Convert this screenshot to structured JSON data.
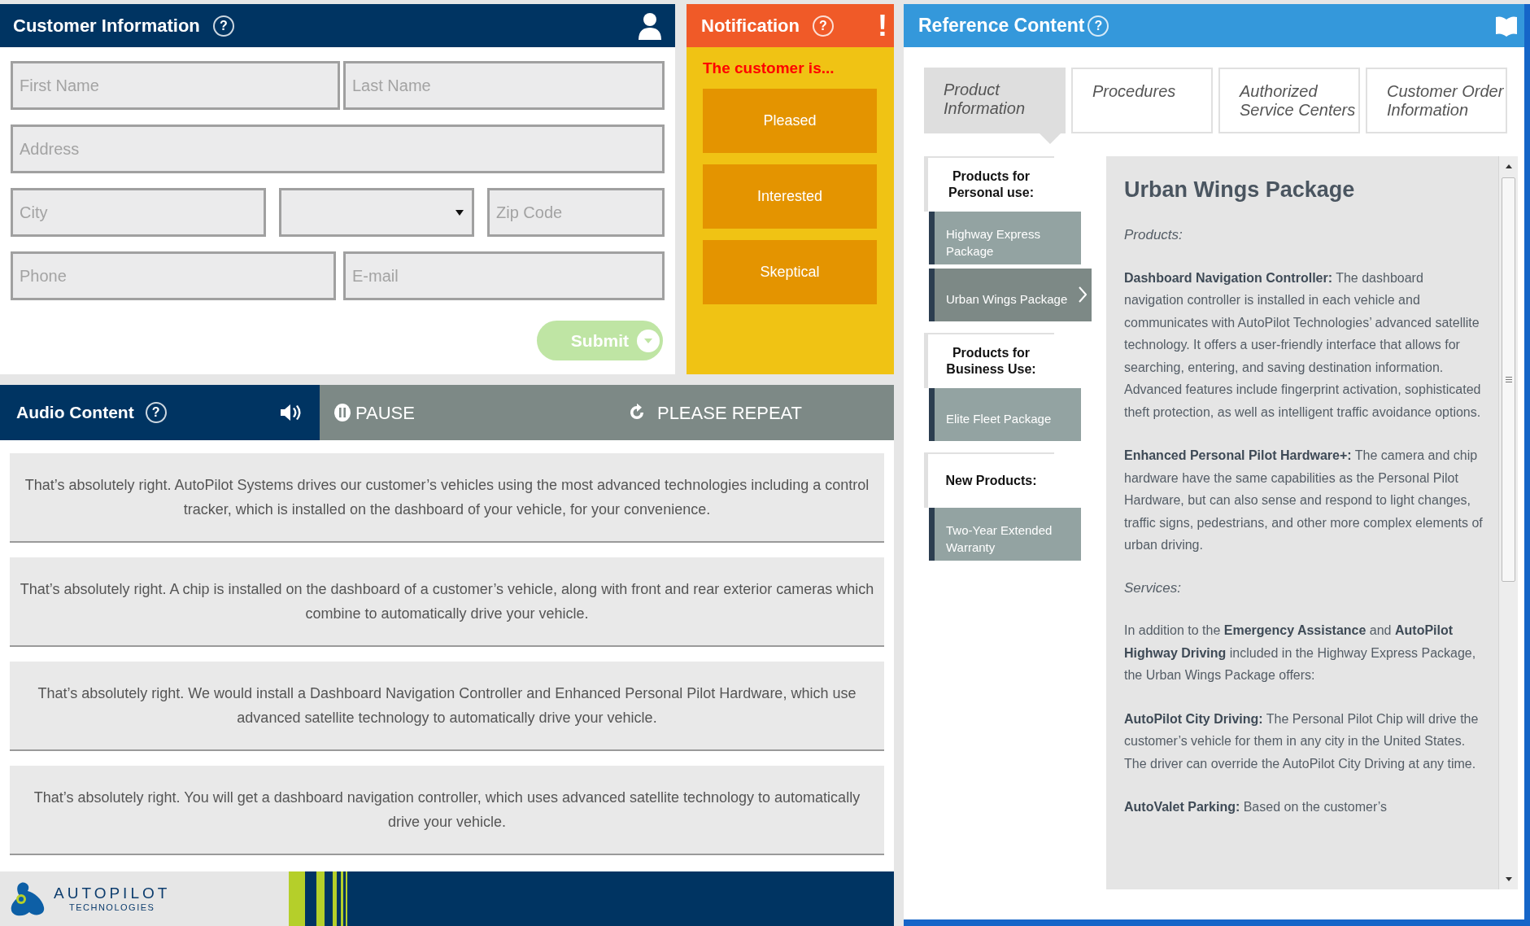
{
  "customer_information": {
    "title": "Customer Information",
    "help": "?",
    "rows": [
      [
        {
          "kind": "text",
          "placeholder": "First Name"
        },
        {
          "kind": "text",
          "placeholder": "Last Name"
        }
      ],
      [
        {
          "kind": "text",
          "placeholder": "Address"
        }
      ],
      [
        {
          "kind": "text",
          "placeholder": "City"
        },
        {
          "kind": "select"
        },
        {
          "kind": "text",
          "placeholder": "Zip Code"
        }
      ],
      [
        {
          "kind": "text",
          "placeholder": "Phone"
        },
        {
          "kind": "text",
          "placeholder": "E-mail"
        }
      ]
    ],
    "submit": "Submit"
  },
  "notification": {
    "title": "Notification",
    "help": "?",
    "alert": "!",
    "prompt": "The customer is...",
    "options": [
      "Pleased",
      "Interested",
      "Skeptical"
    ]
  },
  "audio": {
    "title": "Audio Content",
    "help": "?",
    "pause": "PAUSE",
    "repeat": "PLEASE REPEAT",
    "responses": [
      "That’s absolutely right. AutoPilot Systems drives our customer’s vehicles using the most advanced technologies including a control tracker, which is installed on the dashboard of your vehicle, for your convenience.",
      "That’s absolutely right. A chip is installed on the dashboard of a customer’s vehicle, along with front and rear exterior cameras which combine to automatically drive your vehicle.",
      "That’s absolutely right. We would install a Dashboard Navigation Controller and Enhanced Personal Pilot Hardware, which use advanced satellite technology to automatically drive your vehicle.",
      "That’s absolutely right. You will get a dashboard navigation controller, which uses advanced satellite technology to automatically drive your vehicle."
    ]
  },
  "footer": {
    "logo_name": "AUTOPILOT",
    "logo_sub": "TECHNOLOGIES"
  },
  "reference": {
    "title": "Reference Content",
    "help": "?",
    "tabs": [
      {
        "label": "Product Information",
        "selected": true
      },
      {
        "label": "Procedures",
        "selected": false
      },
      {
        "label": "Authorized Service Centers",
        "selected": false
      },
      {
        "label": "Customer Order Information",
        "selected": false
      }
    ],
    "sidebar": [
      {
        "heading": "Products for Personal use:",
        "items": [
          {
            "label": "Highway Express Package",
            "selected": false
          },
          {
            "label": "Urban Wings Package",
            "selected": true
          }
        ]
      },
      {
        "heading": "Products for Business Use:",
        "items": [
          {
            "label": "Elite Fleet Package",
            "selected": false
          }
        ]
      },
      {
        "heading": "New Products:",
        "items": [
          {
            "label": "Two-Year Extended Warranty",
            "selected": false
          }
        ]
      }
    ],
    "article": {
      "title": "Urban Wings Package",
      "blocks": [
        {
          "kind": "subhead",
          "text": "Products:"
        },
        {
          "kind": "paragraph",
          "text": "**Dashboard Navigation Controller:** The dashboard navigation controller is installed in each vehicle and communicates with AutoPilot Technologies’ advanced satellite technology. It offers a user-friendly interface that allows for searching, entering, and saving destination information. Advanced features include fingerprint activation, sophisticated theft protection, as well as intelligent traffic avoidance options."
        },
        {
          "kind": "paragraph",
          "text": "**Enhanced Personal Pilot Hardware+:** The camera and chip hardware have the same capabilities as the Personal Pilot Hardware, but can also sense and respond to light changes, traffic signs, pedestrians, and other more complex elements of urban driving."
        },
        {
          "kind": "subhead",
          "text": "Services:"
        },
        {
          "kind": "paragraph",
          "text": "In addition to the **Emergency Assistance** and **AutoPilot Highway Driving** included in the Highway Express Package, the Urban Wings Package offers:"
        },
        {
          "kind": "paragraph",
          "text": "**AutoPilot City Driving:** The Personal Pilot Chip will drive the customer’s vehicle for them in any city in the United States. The driver can override the AutoPilot City Driving at any time."
        },
        {
          "kind": "paragraph",
          "text": "**AutoValet Parking:** Based on the customer’s"
        }
      ]
    }
  }
}
